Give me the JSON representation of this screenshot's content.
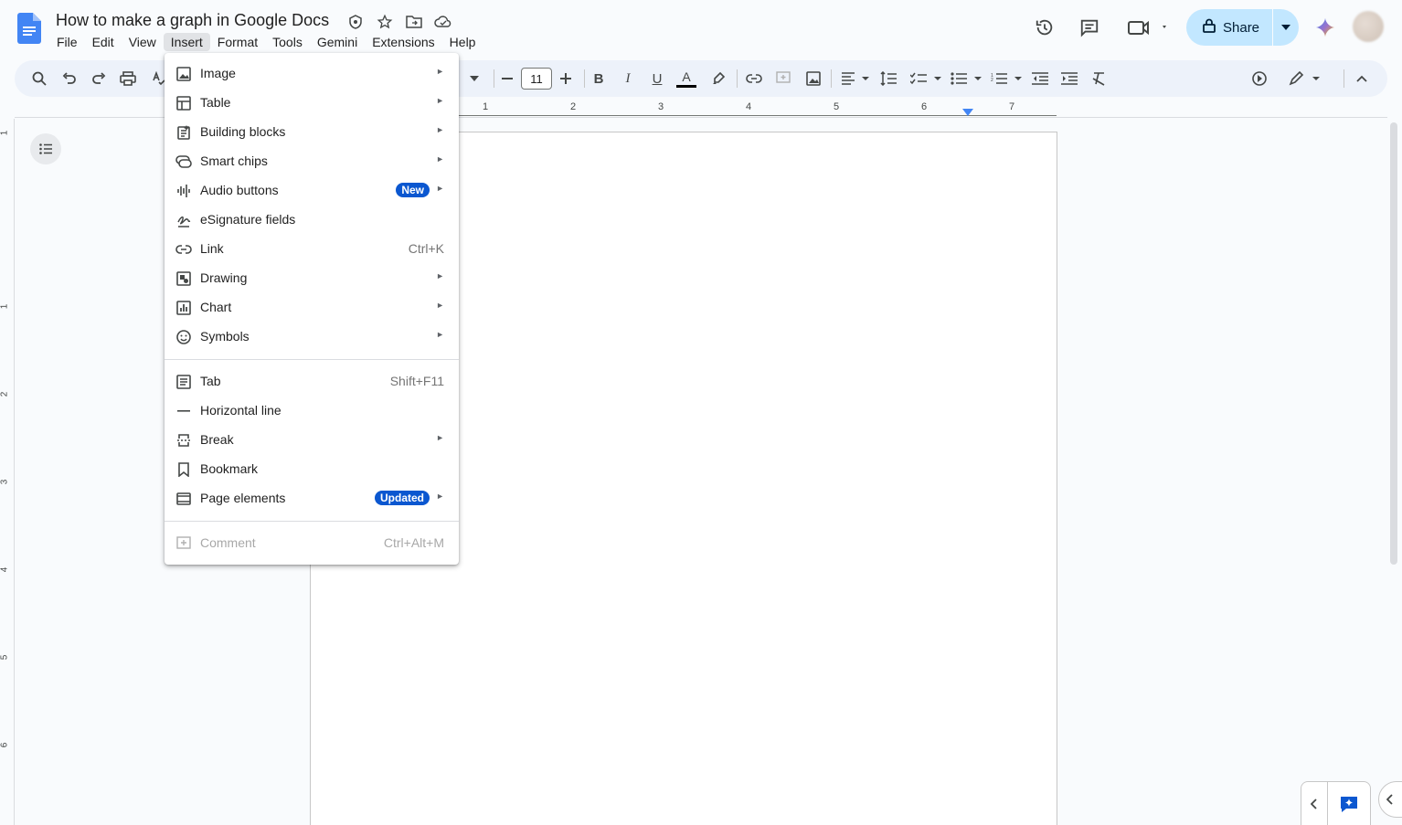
{
  "doc": {
    "title": "How to make a graph in Google Docs"
  },
  "menubar": {
    "items": [
      {
        "label": "File"
      },
      {
        "label": "Edit"
      },
      {
        "label": "View"
      },
      {
        "label": "Insert",
        "active": true
      },
      {
        "label": "Format"
      },
      {
        "label": "Tools"
      },
      {
        "label": "Gemini"
      },
      {
        "label": "Extensions"
      },
      {
        "label": "Help"
      }
    ]
  },
  "header": {
    "share_label": "Share",
    "icons": [
      "version-history-icon",
      "comments-icon",
      "meet-icon",
      "gemini-spark-icon"
    ]
  },
  "toolbar": {
    "font_size": "11",
    "icons": [
      "search-icon",
      "undo-icon",
      "redo-icon",
      "print-icon",
      "spellcheck-icon",
      "font-size-decrease-icon",
      "font-size-increase-icon",
      "bold-icon",
      "italic-icon",
      "underline-icon",
      "text-color-icon",
      "highlight-icon",
      "link-icon",
      "add-comment-icon",
      "insert-image-icon",
      "align-icon",
      "line-spacing-icon",
      "checklist-icon",
      "bulleted-list-icon",
      "numbered-list-icon",
      "decrease-indent-icon",
      "increase-indent-icon",
      "clear-formatting-icon",
      "editing-mode-icon",
      "collapse-toolbar-icon"
    ]
  },
  "ruler": {
    "numbers": [
      "1",
      "2",
      "3",
      "4",
      "5",
      "6",
      "7"
    ],
    "vertical_numbers": [
      "1",
      "1",
      "2",
      "3",
      "4",
      "5",
      "6"
    ]
  },
  "insert_menu": {
    "items": [
      {
        "label": "Image",
        "icon": "image-icon",
        "submenu": true
      },
      {
        "label": "Table",
        "icon": "table-icon",
        "submenu": true
      },
      {
        "label": "Building blocks",
        "icon": "building-blocks-icon",
        "submenu": true
      },
      {
        "label": "Smart chips",
        "icon": "smart-chips-icon",
        "submenu": true
      },
      {
        "label": "Audio buttons",
        "icon": "audio-icon",
        "submenu": true,
        "badge": "New"
      },
      {
        "label": "eSignature fields",
        "icon": "esignature-icon",
        "submenu": false
      },
      {
        "label": "Link",
        "icon": "link-icon",
        "shortcut": "Ctrl+K"
      },
      {
        "label": "Drawing",
        "icon": "drawing-icon",
        "submenu": true
      },
      {
        "label": "Chart",
        "icon": "chart-icon",
        "submenu": true
      },
      {
        "label": "Symbols",
        "icon": "symbols-icon",
        "submenu": true
      },
      {
        "label": "Tab",
        "icon": "tab-icon",
        "shortcut": "Shift+F11"
      },
      {
        "label": "Horizontal line",
        "icon": "horizontal-line-icon"
      },
      {
        "label": "Break",
        "icon": "break-icon",
        "submenu": true
      },
      {
        "label": "Bookmark",
        "icon": "bookmark-icon"
      },
      {
        "label": "Page elements",
        "icon": "page-elements-icon",
        "submenu": true,
        "badge": "Updated"
      },
      {
        "label": "Comment",
        "icon": "comment-add-icon",
        "shortcut": "Ctrl+Alt+M",
        "disabled": true
      }
    ]
  },
  "colors": {
    "accent": "#0b57d0",
    "share_bg": "#c2e7ff",
    "toolbar_bg": "#edf2fa",
    "page_bg": "#f9fbfd"
  }
}
